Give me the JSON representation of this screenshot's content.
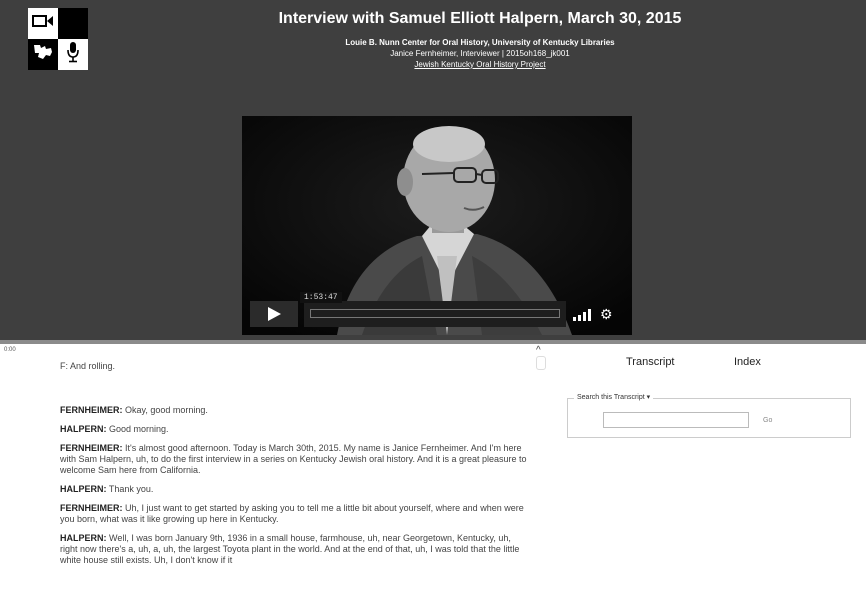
{
  "header": {
    "title": "Interview with Samuel Elliott Halpern, March 30, 2015",
    "institution": "Louie B. Nunn Center for Oral History, University of Kentucky Libraries",
    "interviewer_line": "Janice Fernheimer, Interviewer | 2015oh168_jk001",
    "project_link": "Jewish Kentucky Oral History Project"
  },
  "logo": {
    "icons": [
      "video-camera-icon",
      "kentucky-state-icon",
      "microphone-icon"
    ]
  },
  "video": {
    "time_tooltip": "1:53:47",
    "icons": [
      "play-icon",
      "volume-bars-icon",
      "gear-icon"
    ]
  },
  "transcript_view": {
    "start_time": "0:00",
    "first_line": "F: And rolling.",
    "paragraphs": [
      {
        "speaker": "FERNHEIMER:",
        "text": " Okay, good morning."
      },
      {
        "speaker": "HALPERN:",
        "text": " Good morning."
      },
      {
        "speaker": "FERNHEIMER:",
        "text": " It's almost good afternoon. Today is March 30th, 2015. My name is Janice Fernheimer. And I'm here with Sam Halpern, uh, to do the first interview in a series on Kentucky Jewish oral history. And it is a great pleasure to welcome Sam here from California."
      },
      {
        "speaker": "HALPERN:",
        "text": " Thank you."
      },
      {
        "speaker": "FERNHEIMER:",
        "text": " Uh, I just want to get started by asking you to tell me a little bit about yourself, where and when were you born, what was it like growing up here in Kentucky."
      },
      {
        "speaker": "HALPERN:",
        "text": " Well, I was born January 9th, 1936 in a small house, farmhouse, uh, near Georgetown, Kentucky, uh, right now there's a, uh, a, uh, the largest Toyota plant in the world. And at the end of that, uh, I was told that the little white house still exists. Uh, I don't know if it"
      }
    ]
  },
  "tabs": {
    "transcript": "Transcript",
    "index": "Index"
  },
  "search": {
    "legend": "Search this Transcript ▾",
    "value": "",
    "placeholder": "",
    "go_label": "Go"
  }
}
